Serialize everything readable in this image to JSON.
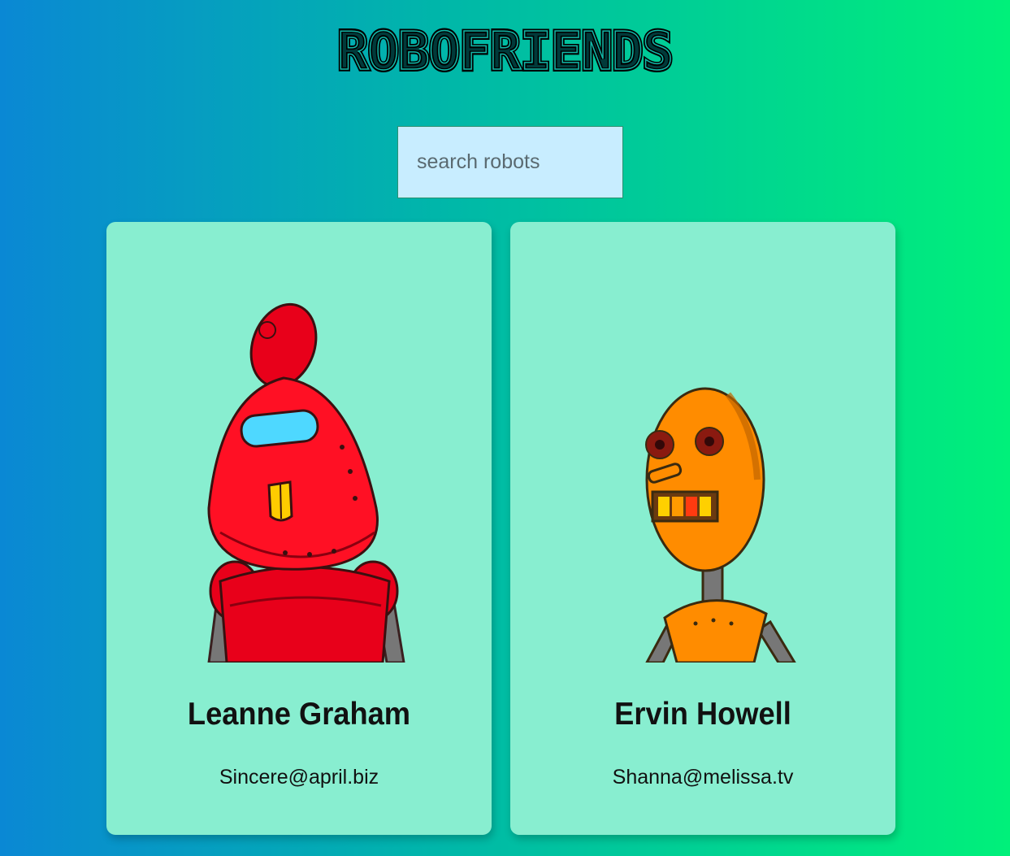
{
  "app": {
    "title": "ROBOFRIENDS"
  },
  "search": {
    "placeholder": "search robots",
    "value": ""
  },
  "robots": [
    {
      "name": "Leanne Graham",
      "email": "Sincere@april.biz",
      "color": "#ff1024",
      "image_icon": "red-robot-icon"
    },
    {
      "name": "Ervin Howell",
      "email": "Shanna@melissa.tv",
      "color": "#ff8c00",
      "image_icon": "orange-robot-icon"
    }
  ],
  "colors": {
    "background_start": "#0a88d4",
    "background_end": "#00f07a",
    "card": "#88eed0",
    "search_bg": "#c8edff"
  }
}
